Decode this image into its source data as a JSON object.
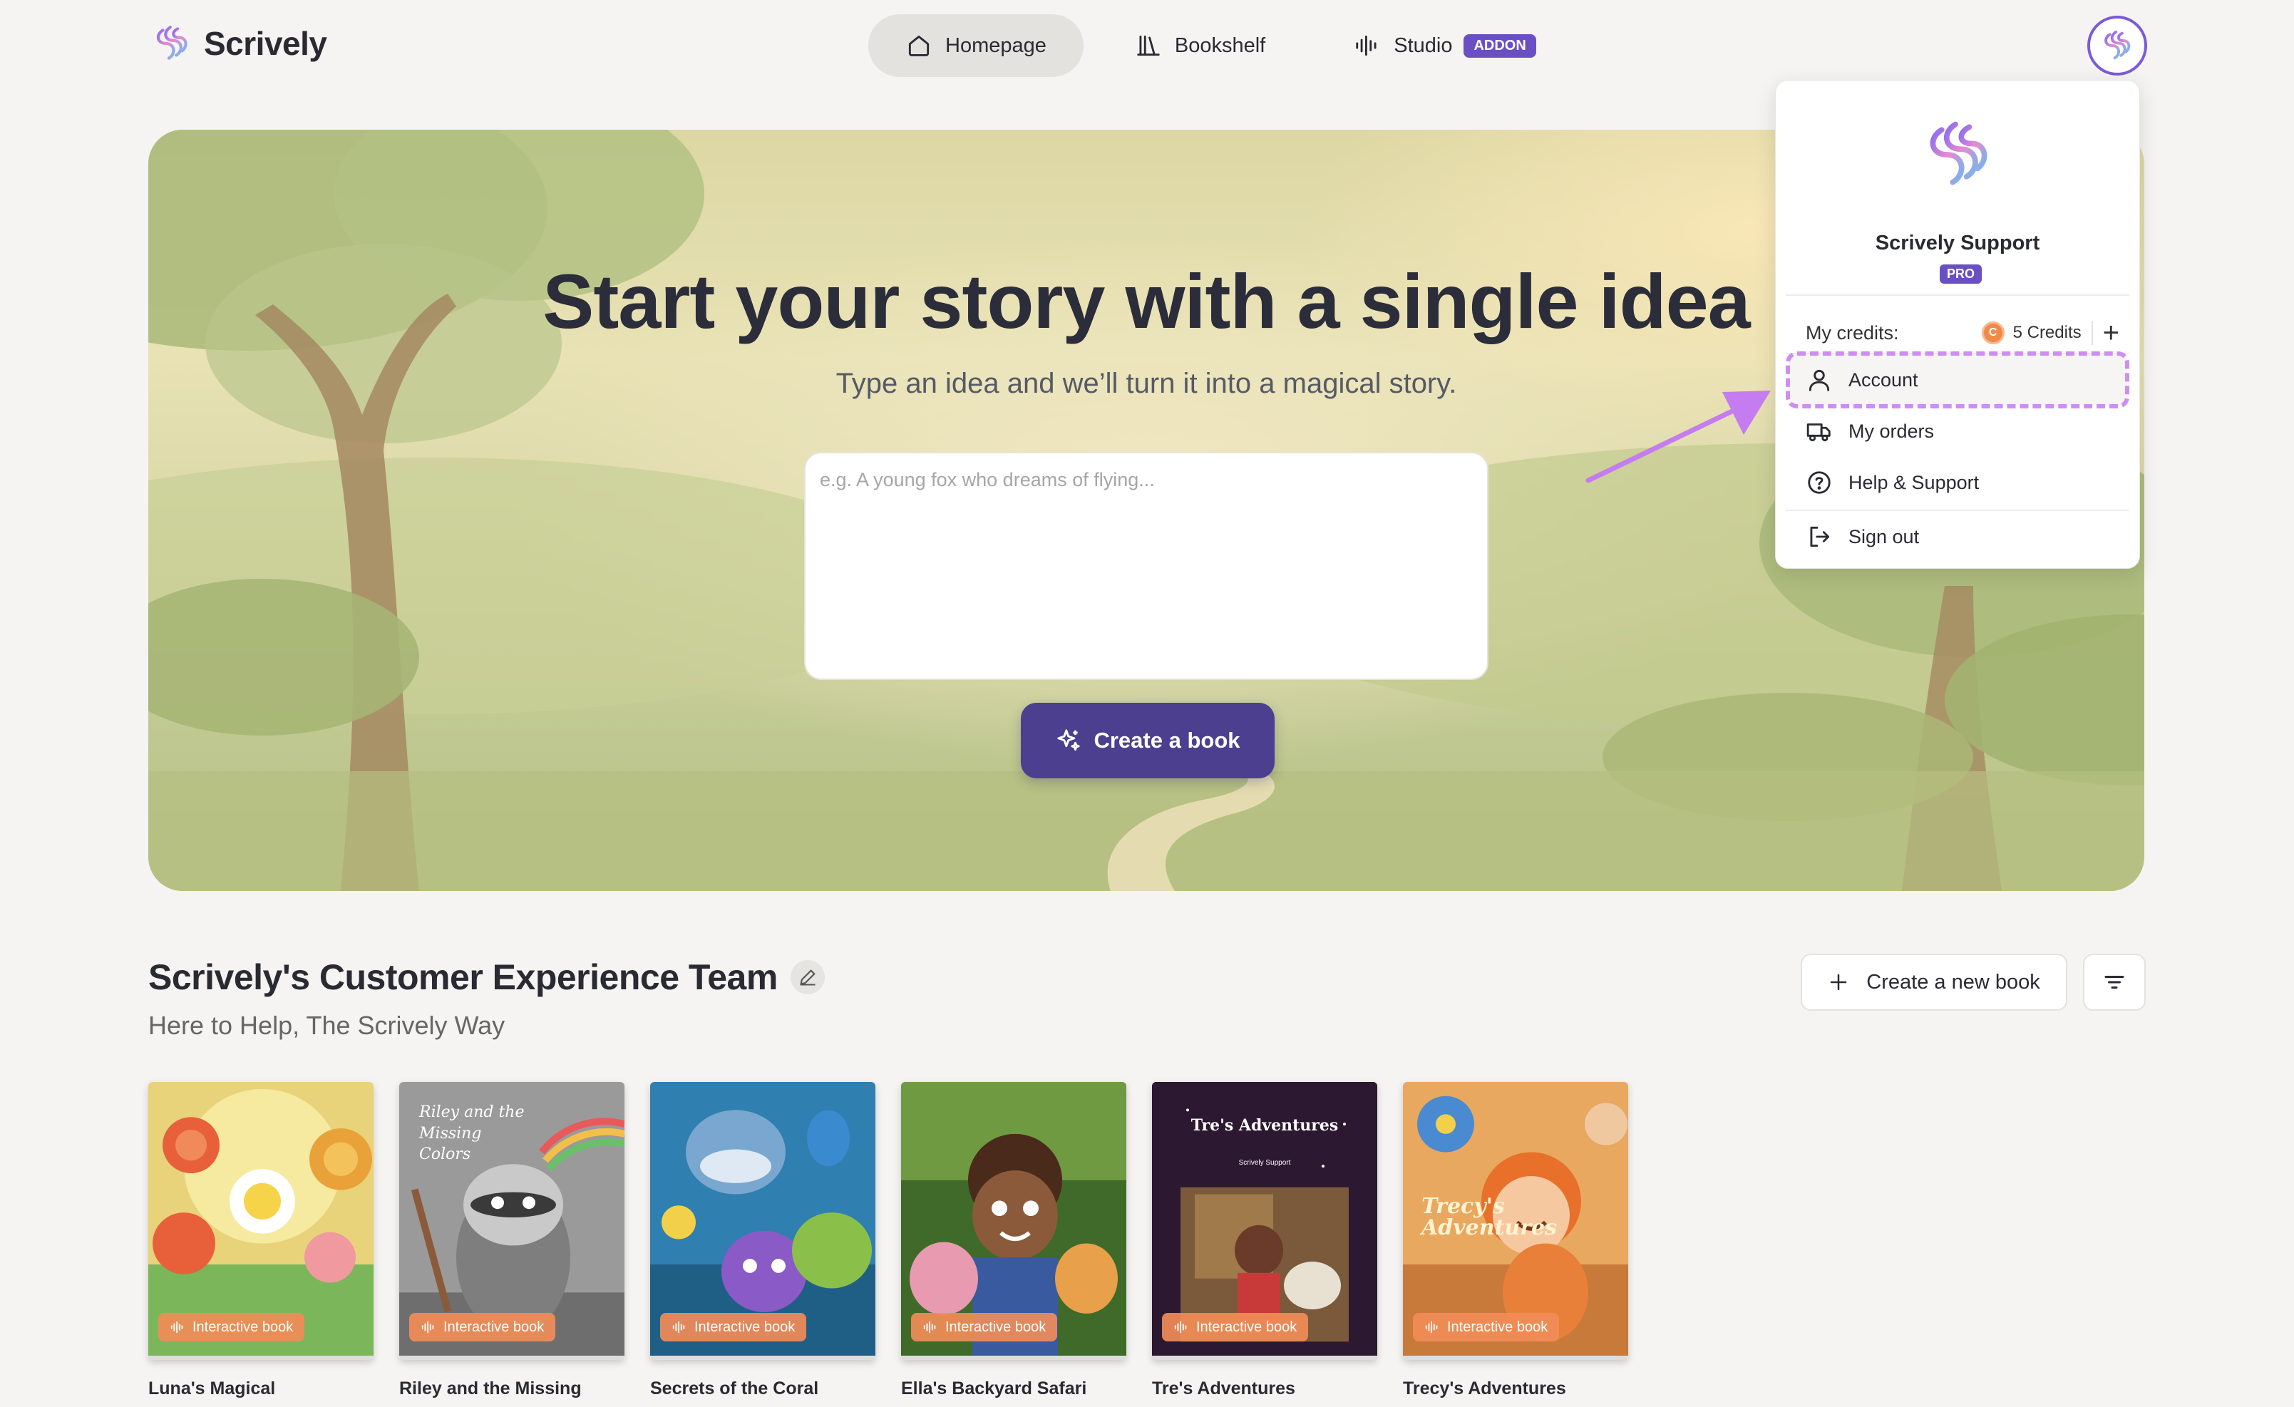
{
  "brand": {
    "name": "Scrively"
  },
  "nav": {
    "items": [
      {
        "label": "Homepage",
        "icon": "home-icon"
      },
      {
        "label": "Bookshelf",
        "icon": "bookshelf-icon"
      },
      {
        "label": "Studio",
        "icon": "audio-wave-icon"
      }
    ],
    "studio_badge": "ADDON"
  },
  "hero": {
    "title": "Start your story with a single idea",
    "subtitle": "Type an idea and we’ll turn it into a magical story.",
    "input_placeholder": "e.g. A young fox who dreams of flying...",
    "create_button": "Create a book"
  },
  "profile_menu": {
    "name": "Scrively Support",
    "plan": "PRO",
    "credits_label": "My credits:",
    "credits_coin": "C",
    "credits_value": "5 Credits",
    "add_label": "+",
    "items": [
      {
        "label": "Account",
        "icon": "user-icon",
        "highlighted": true
      },
      {
        "label": "My orders",
        "icon": "truck-icon"
      },
      {
        "label": "Help & Support",
        "icon": "help-circle-icon"
      },
      {
        "label": "Sign out",
        "icon": "sign-out-icon"
      }
    ]
  },
  "section": {
    "title": "Scrively's Customer Experience Team",
    "subtitle": "Here to Help, The Scrively Way",
    "new_book_button": "Create a new book"
  },
  "books": [
    {
      "title": "Luna's Magical",
      "badge": "Interactive book"
    },
    {
      "title": "Riley and the Missing",
      "badge": "Interactive book",
      "cover_text": "Riley and the Missing Colors"
    },
    {
      "title": "Secrets of the Coral",
      "badge": "Interactive book"
    },
    {
      "title": "Ella's Backyard Safari",
      "badge": "Interactive book"
    },
    {
      "title": "Tre's Adventures",
      "badge": "Interactive book",
      "cover_text": "Tre's Adventures",
      "cover_author": "Scrively Support"
    },
    {
      "title": "Trecy's Adventures",
      "badge": "Interactive book",
      "cover_text": "Trecy's Adventures"
    }
  ],
  "colors": {
    "accent": "#4c3f8f",
    "pro_badge": "#6a4fc4",
    "highlight_outline": "#cf8df0",
    "badge_orange": "#f18c58"
  }
}
